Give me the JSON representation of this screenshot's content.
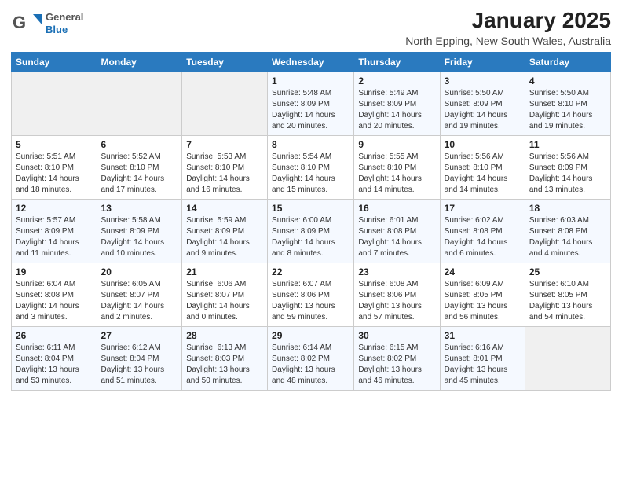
{
  "logo": {
    "general": "General",
    "blue": "Blue"
  },
  "header": {
    "month": "January 2025",
    "location": "North Epping, New South Wales, Australia"
  },
  "weekdays": [
    "Sunday",
    "Monday",
    "Tuesday",
    "Wednesday",
    "Thursday",
    "Friday",
    "Saturday"
  ],
  "weeks": [
    [
      {
        "day": "",
        "info": ""
      },
      {
        "day": "",
        "info": ""
      },
      {
        "day": "",
        "info": ""
      },
      {
        "day": "1",
        "info": "Sunrise: 5:48 AM\nSunset: 8:09 PM\nDaylight: 14 hours\nand 20 minutes."
      },
      {
        "day": "2",
        "info": "Sunrise: 5:49 AM\nSunset: 8:09 PM\nDaylight: 14 hours\nand 20 minutes."
      },
      {
        "day": "3",
        "info": "Sunrise: 5:50 AM\nSunset: 8:09 PM\nDaylight: 14 hours\nand 19 minutes."
      },
      {
        "day": "4",
        "info": "Sunrise: 5:50 AM\nSunset: 8:10 PM\nDaylight: 14 hours\nand 19 minutes."
      }
    ],
    [
      {
        "day": "5",
        "info": "Sunrise: 5:51 AM\nSunset: 8:10 PM\nDaylight: 14 hours\nand 18 minutes."
      },
      {
        "day": "6",
        "info": "Sunrise: 5:52 AM\nSunset: 8:10 PM\nDaylight: 14 hours\nand 17 minutes."
      },
      {
        "day": "7",
        "info": "Sunrise: 5:53 AM\nSunset: 8:10 PM\nDaylight: 14 hours\nand 16 minutes."
      },
      {
        "day": "8",
        "info": "Sunrise: 5:54 AM\nSunset: 8:10 PM\nDaylight: 14 hours\nand 15 minutes."
      },
      {
        "day": "9",
        "info": "Sunrise: 5:55 AM\nSunset: 8:10 PM\nDaylight: 14 hours\nand 14 minutes."
      },
      {
        "day": "10",
        "info": "Sunrise: 5:56 AM\nSunset: 8:10 PM\nDaylight: 14 hours\nand 14 minutes."
      },
      {
        "day": "11",
        "info": "Sunrise: 5:56 AM\nSunset: 8:09 PM\nDaylight: 14 hours\nand 13 minutes."
      }
    ],
    [
      {
        "day": "12",
        "info": "Sunrise: 5:57 AM\nSunset: 8:09 PM\nDaylight: 14 hours\nand 11 minutes."
      },
      {
        "day": "13",
        "info": "Sunrise: 5:58 AM\nSunset: 8:09 PM\nDaylight: 14 hours\nand 10 minutes."
      },
      {
        "day": "14",
        "info": "Sunrise: 5:59 AM\nSunset: 8:09 PM\nDaylight: 14 hours\nand 9 minutes."
      },
      {
        "day": "15",
        "info": "Sunrise: 6:00 AM\nSunset: 8:09 PM\nDaylight: 14 hours\nand 8 minutes."
      },
      {
        "day": "16",
        "info": "Sunrise: 6:01 AM\nSunset: 8:08 PM\nDaylight: 14 hours\nand 7 minutes."
      },
      {
        "day": "17",
        "info": "Sunrise: 6:02 AM\nSunset: 8:08 PM\nDaylight: 14 hours\nand 6 minutes."
      },
      {
        "day": "18",
        "info": "Sunrise: 6:03 AM\nSunset: 8:08 PM\nDaylight: 14 hours\nand 4 minutes."
      }
    ],
    [
      {
        "day": "19",
        "info": "Sunrise: 6:04 AM\nSunset: 8:08 PM\nDaylight: 14 hours\nand 3 minutes."
      },
      {
        "day": "20",
        "info": "Sunrise: 6:05 AM\nSunset: 8:07 PM\nDaylight: 14 hours\nand 2 minutes."
      },
      {
        "day": "21",
        "info": "Sunrise: 6:06 AM\nSunset: 8:07 PM\nDaylight: 14 hours\nand 0 minutes."
      },
      {
        "day": "22",
        "info": "Sunrise: 6:07 AM\nSunset: 8:06 PM\nDaylight: 13 hours\nand 59 minutes."
      },
      {
        "day": "23",
        "info": "Sunrise: 6:08 AM\nSunset: 8:06 PM\nDaylight: 13 hours\nand 57 minutes."
      },
      {
        "day": "24",
        "info": "Sunrise: 6:09 AM\nSunset: 8:05 PM\nDaylight: 13 hours\nand 56 minutes."
      },
      {
        "day": "25",
        "info": "Sunrise: 6:10 AM\nSunset: 8:05 PM\nDaylight: 13 hours\nand 54 minutes."
      }
    ],
    [
      {
        "day": "26",
        "info": "Sunrise: 6:11 AM\nSunset: 8:04 PM\nDaylight: 13 hours\nand 53 minutes."
      },
      {
        "day": "27",
        "info": "Sunrise: 6:12 AM\nSunset: 8:04 PM\nDaylight: 13 hours\nand 51 minutes."
      },
      {
        "day": "28",
        "info": "Sunrise: 6:13 AM\nSunset: 8:03 PM\nDaylight: 13 hours\nand 50 minutes."
      },
      {
        "day": "29",
        "info": "Sunrise: 6:14 AM\nSunset: 8:02 PM\nDaylight: 13 hours\nand 48 minutes."
      },
      {
        "day": "30",
        "info": "Sunrise: 6:15 AM\nSunset: 8:02 PM\nDaylight: 13 hours\nand 46 minutes."
      },
      {
        "day": "31",
        "info": "Sunrise: 6:16 AM\nSunset: 8:01 PM\nDaylight: 13 hours\nand 45 minutes."
      },
      {
        "day": "",
        "info": ""
      }
    ]
  ]
}
